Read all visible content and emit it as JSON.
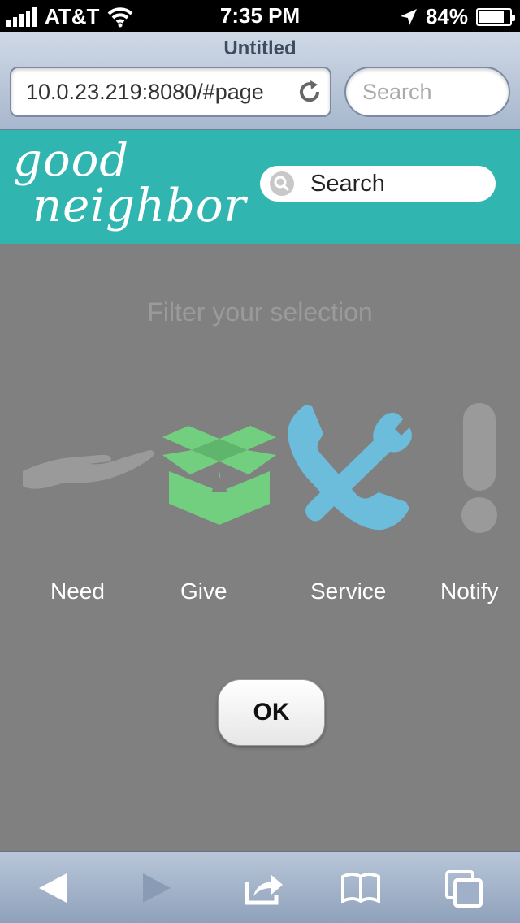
{
  "status_bar": {
    "carrier": "AT&T",
    "time": "7:35 PM",
    "battery": "84%",
    "battery_level": 0.84
  },
  "browser": {
    "title": "Untitled",
    "url": "10.0.23.219:8080/#page",
    "search_placeholder": "Search"
  },
  "app": {
    "logo_line1": "good",
    "logo_line2": "neighbor",
    "search_placeholder": "Search"
  },
  "filter": {
    "title": "Filter your selection",
    "options": [
      {
        "label": "Need",
        "icon": "hand-icon",
        "color": "#9a9a9a",
        "active": false
      },
      {
        "label": "Give",
        "icon": "box-icon",
        "color": "#72cf7f",
        "active": true
      },
      {
        "label": "Service",
        "icon": "phone-wrench-icon",
        "color": "#6cbcdc",
        "active": true
      },
      {
        "label": "Notify",
        "icon": "exclamation-icon",
        "color": "#9a9a9a",
        "active": false
      }
    ],
    "ok_label": "OK"
  },
  "toolbar": {
    "items": [
      "back-icon",
      "forward-icon",
      "share-icon",
      "bookmarks-icon",
      "tabs-icon"
    ]
  },
  "colors": {
    "header_teal": "#30b5b0",
    "overlay_gray": "#808080"
  }
}
